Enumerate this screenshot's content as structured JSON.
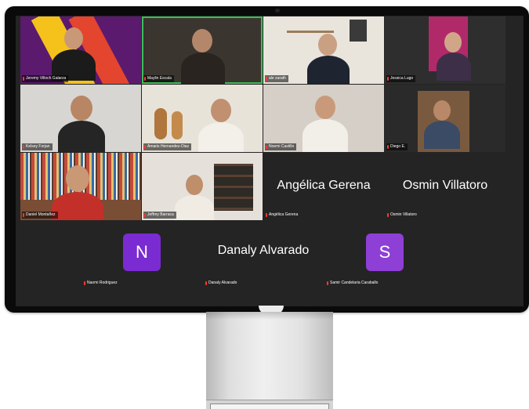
{
  "meeting": {
    "participants": [
      {
        "name": "Jeremy Villoch Galarza",
        "kind": "video"
      },
      {
        "name": "Maylin Escala",
        "kind": "video",
        "speaking": true
      },
      {
        "name": "ale zarath",
        "kind": "video"
      },
      {
        "name": "Jessica Lugo",
        "kind": "video"
      },
      {
        "name": "Kelsey Forjan",
        "kind": "video"
      },
      {
        "name": "Amaris Hernandez-Diaz",
        "kind": "video"
      },
      {
        "name": "Noemi Castillo",
        "kind": "video"
      },
      {
        "name": "Diego E.",
        "kind": "video"
      },
      {
        "name": "Daniel Montañez",
        "kind": "video"
      },
      {
        "name": "Jeffrey Barraca",
        "kind": "video"
      },
      {
        "name": "Angélica Gerena",
        "kind": "name",
        "display": "Angélica Gerena"
      },
      {
        "name": "Osmin Villatoro",
        "kind": "name",
        "display": "Osmin Villatoro"
      },
      {
        "name": "Naomi Rodriguez",
        "kind": "avatar",
        "initial": "N"
      },
      {
        "name": "Danaly Alvarado",
        "kind": "name",
        "display": "Danaly Alvarado"
      },
      {
        "name": "Samir Candelaria Caraballo",
        "kind": "avatar",
        "initial": "S"
      }
    ],
    "colors": {
      "background": "#242424",
      "speaking_border": "#3bbf57",
      "avatar_purple": "#7a2bd1",
      "muted_mic": "#ff3b30"
    },
    "icons": {
      "muted_mic": "mic-muted-icon"
    }
  }
}
